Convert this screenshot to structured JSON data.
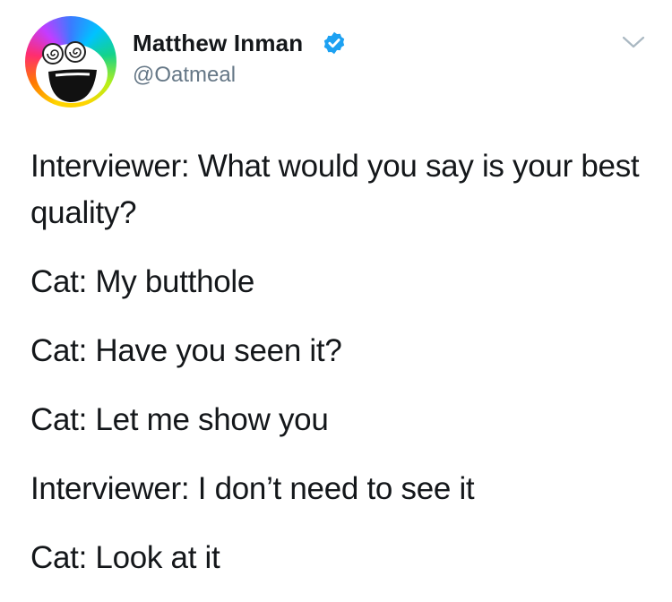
{
  "author": {
    "display_name": "Matthew Inman",
    "handle": "@Oatmeal",
    "verified_icon": "verified-badge-icon",
    "avatar_icon": "oatmeal-rainbow-face-avatar",
    "colors": {
      "name": "#14171a",
      "handle": "#657786",
      "verified": "#1da1f2"
    }
  },
  "menu": {
    "icon": "chevron-down-icon",
    "color": "#aab8c2"
  },
  "tweet": {
    "lines": [
      "Interviewer: What would you say is your best quality?",
      "Cat: My butthole",
      "Cat: Have you seen it?",
      "Cat: Let me show you",
      "Interviewer: I don’t need to see it",
      "Cat: Look at it"
    ]
  }
}
